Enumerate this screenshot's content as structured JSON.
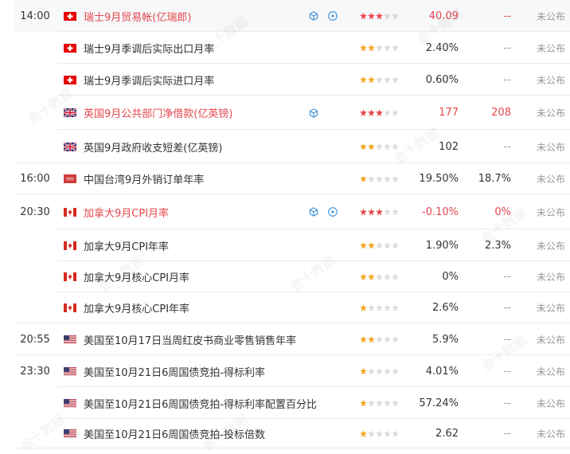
{
  "published_text": "未公布",
  "watermark": "金十数据",
  "rows": [
    {
      "time": "14:00",
      "flag": "ch",
      "title": "瑞士9月贸易帐(亿瑞郎)",
      "important": true,
      "icons": true,
      "stars": 3,
      "actual": "40.09",
      "forecast": "--",
      "highlight": true
    },
    {
      "time": "",
      "flag": "ch",
      "title": "瑞士9月季调后实际出口月率",
      "important": false,
      "icons": false,
      "stars": 2,
      "actual": "2.40%",
      "forecast": "--"
    },
    {
      "time": "",
      "flag": "ch",
      "title": "瑞士9月季调后实际进口月率",
      "important": false,
      "icons": false,
      "stars": 2,
      "actual": "0.60%",
      "forecast": "--"
    },
    {
      "time": "",
      "flag": "gb",
      "title": "英国9月公共部门净借款(亿英镑)",
      "important": true,
      "icons": "hex",
      "stars": 3,
      "actual": "177",
      "forecast": "208"
    },
    {
      "time": "",
      "flag": "gb",
      "title": "英国9月政府收支短差(亿英镑)",
      "important": false,
      "icons": false,
      "stars": 2,
      "actual": "102",
      "forecast": "--"
    },
    {
      "time": "16:00",
      "flag": "tw",
      "title": "中国台湾9月外销订单年率",
      "important": false,
      "icons": false,
      "stars": 1,
      "actual": "19.50%",
      "forecast": "18.7%"
    },
    {
      "time": "20:30",
      "flag": "ca",
      "title": "加拿大9月CPI月率",
      "important": true,
      "icons": true,
      "stars": 3,
      "actual": "-0.10%",
      "forecast": "0%"
    },
    {
      "time": "",
      "flag": "ca",
      "title": "加拿大9月CPI年率",
      "important": false,
      "icons": false,
      "stars": 2,
      "actual": "1.90%",
      "forecast": "2.3%"
    },
    {
      "time": "",
      "flag": "ca",
      "title": "加拿大9月核心CPI月率",
      "important": false,
      "icons": false,
      "stars": 2,
      "actual": "0%",
      "forecast": "--"
    },
    {
      "time": "",
      "flag": "ca",
      "title": "加拿大9月核心CPI年率",
      "important": false,
      "icons": false,
      "stars": 1,
      "actual": "2.6%",
      "forecast": "--"
    },
    {
      "time": "20:55",
      "flag": "us",
      "title": "美国至10月17日当周红皮书商业零售销售年率",
      "important": false,
      "icons": false,
      "stars": 2,
      "actual": "5.9%",
      "forecast": "--"
    },
    {
      "time": "23:30",
      "flag": "us",
      "title": "美国至10月21日6周国债竞拍-得标利率",
      "important": false,
      "icons": false,
      "stars": 1,
      "actual": "4.01%",
      "forecast": "--"
    },
    {
      "time": "",
      "flag": "us",
      "title": "美国至10月21日6周国债竞拍-得标利率配置百分比",
      "important": false,
      "icons": false,
      "stars": 1,
      "actual": "57.24%",
      "forecast": "--"
    },
    {
      "time": "",
      "flag": "us",
      "title": "美国至10月21日6周国债竞拍-投标倍数",
      "important": false,
      "icons": false,
      "stars": 1,
      "actual": "2.62",
      "forecast": "--"
    }
  ]
}
